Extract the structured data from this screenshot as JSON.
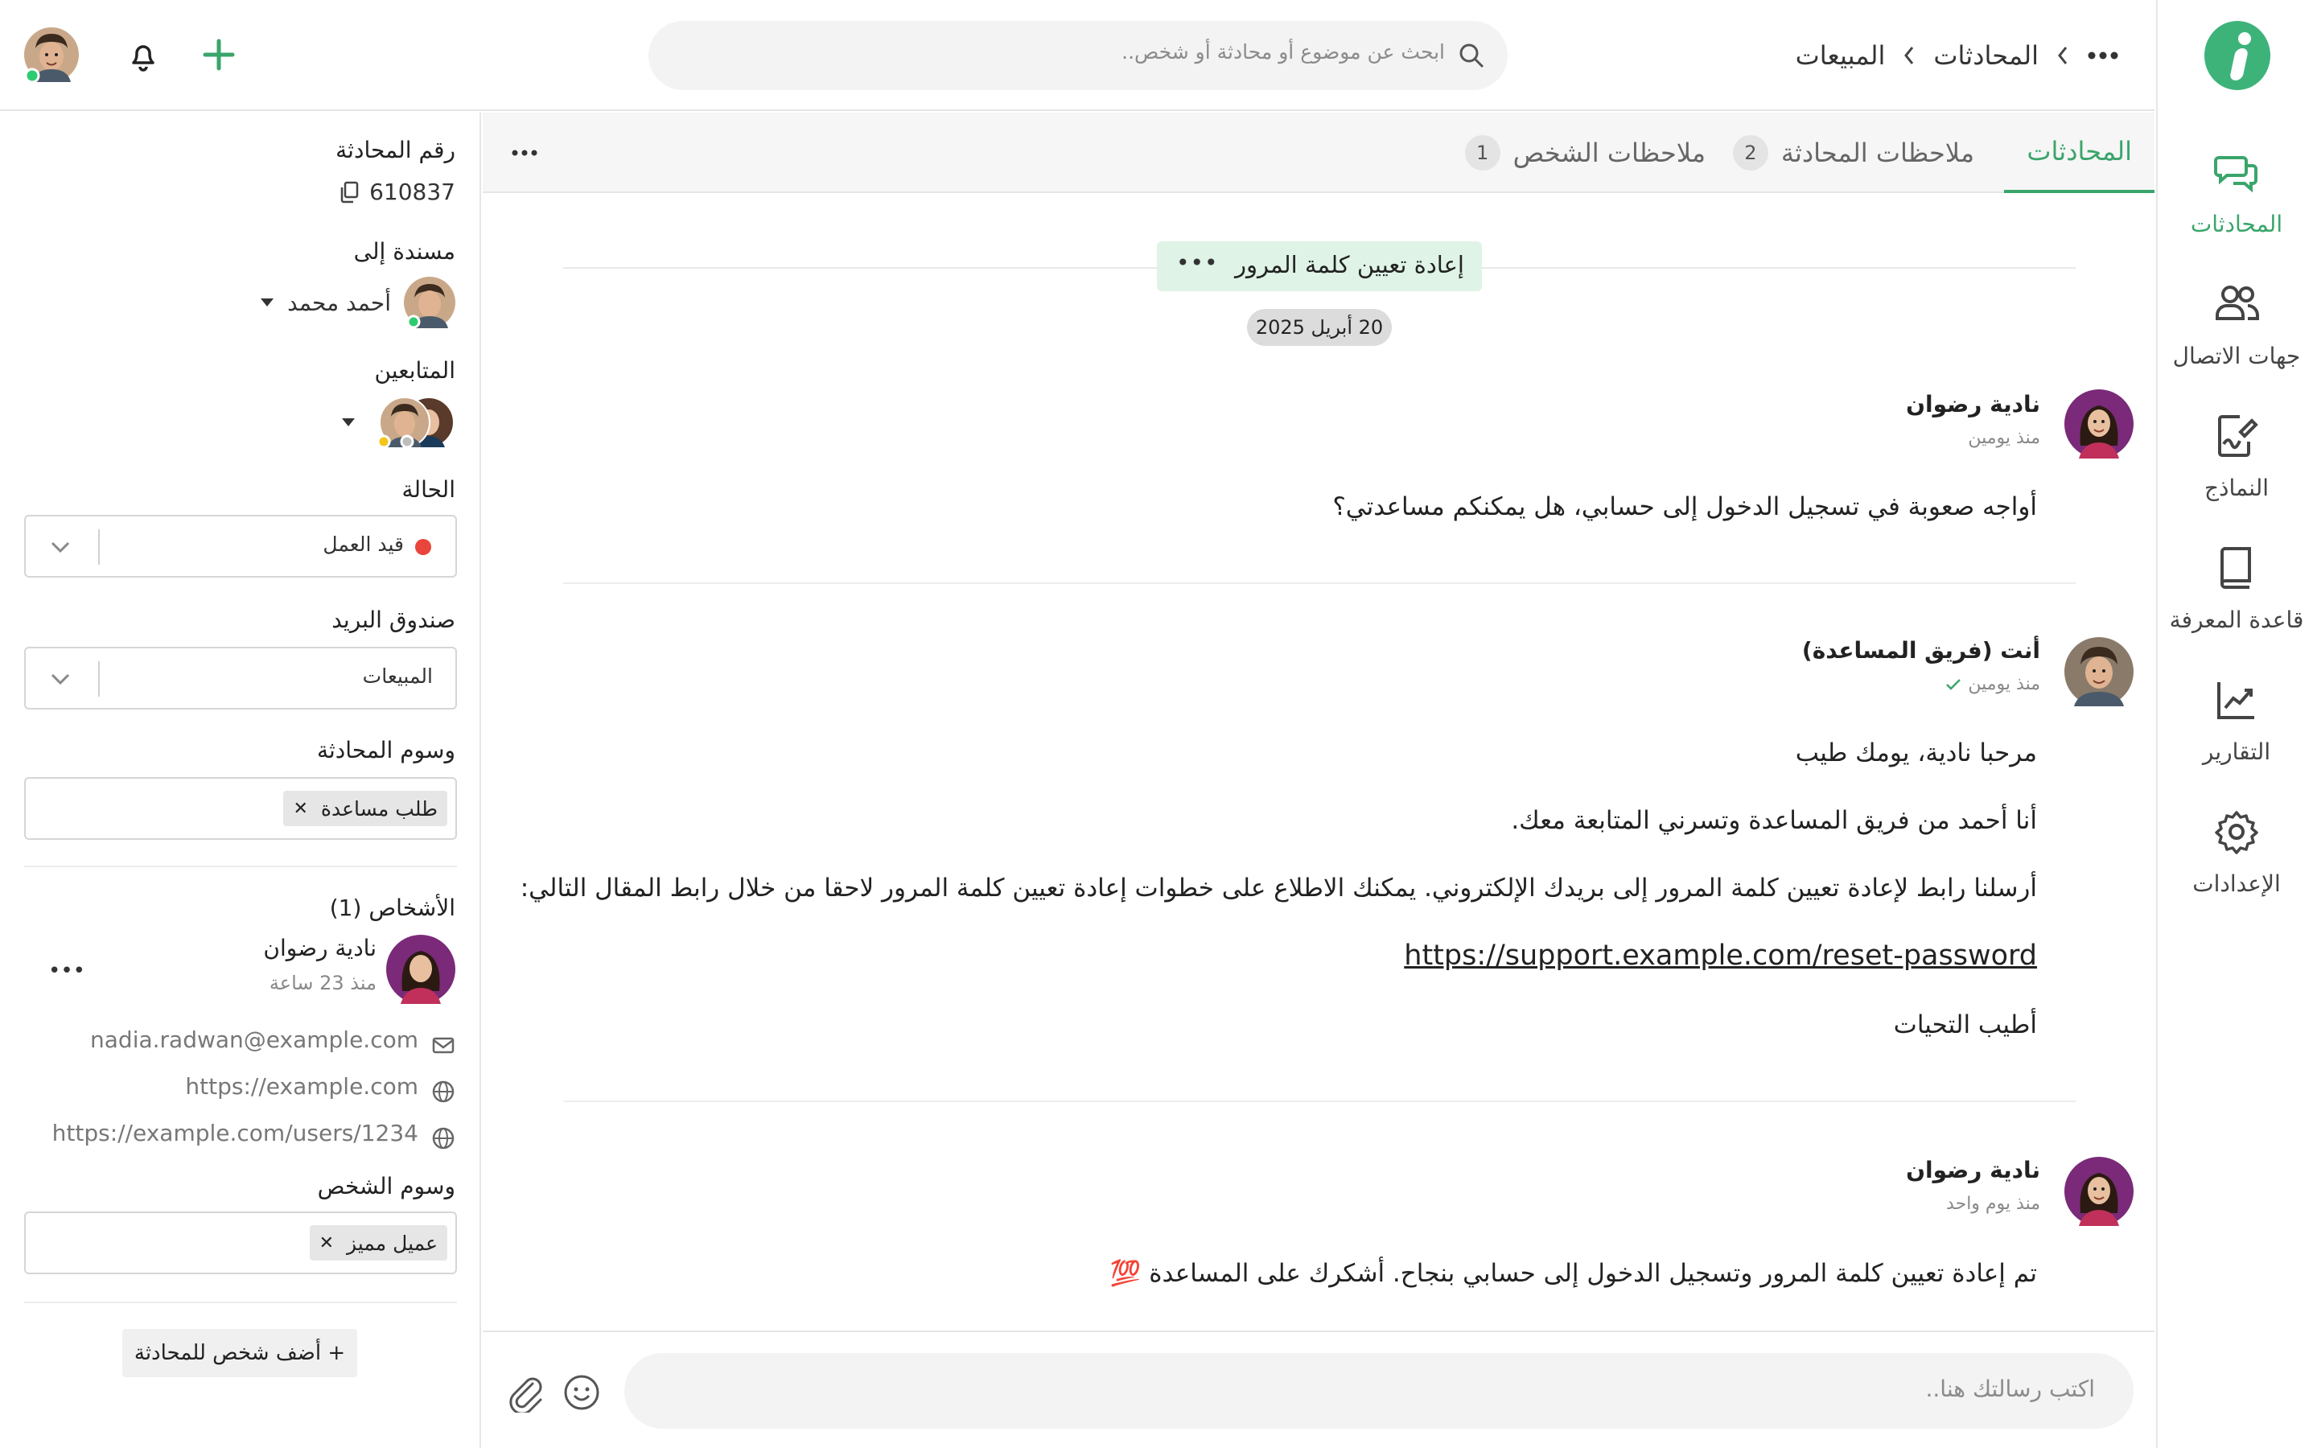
{
  "header": {
    "breadcrumb": [
      "المحادثات",
      "المبيعات"
    ],
    "search_placeholder": "ابحث عن موضوع أو محادثة أو شخص.."
  },
  "nav": {
    "items": [
      {
        "label": "المحادثات",
        "icon": "chat-bubbles-icon",
        "active": true
      },
      {
        "label": "جهات الاتصال",
        "icon": "contacts-icon",
        "active": false
      },
      {
        "label": "النماذج",
        "icon": "forms-icon",
        "active": false
      },
      {
        "label": "قاعدة المعرفة",
        "icon": "book-icon",
        "active": false
      },
      {
        "label": "التقارير",
        "icon": "chart-icon",
        "active": false
      },
      {
        "label": "الإعدادات",
        "icon": "gear-icon",
        "active": false
      }
    ]
  },
  "tabs": [
    {
      "label": "المحادثات",
      "active": true
    },
    {
      "label": "ملاحظات المحادثة",
      "count": "2"
    },
    {
      "label": "ملاحظات الشخص",
      "count": "1"
    }
  ],
  "conversation": {
    "subject": "إعادة تعيين كلمة المرور",
    "date": "20 أبريل 2025",
    "messages": [
      {
        "author": "نادية رضوان",
        "time": "منذ يومين",
        "lines": [
          "أواجه صعوبة في تسجيل الدخول إلى حسابي، هل يمكنكم مساعدتي؟"
        ]
      },
      {
        "author": "أنت (فريق المساعدة)",
        "time": "منذ يومين",
        "lines": [
          "مرحبا نادية، يومك طيب",
          "أنا أحمد من فريق المساعدة وتسرني المتابعة معك.",
          "أرسلنا رابط لإعادة تعيين كلمة المرور إلى بريدك الإلكتروني. يمكنك الاطلاع على خطوات إعادة تعيين كلمة المرور لاحقا من خلال رابط المقال التالي:",
          "https://support.example.com/reset-password",
          "أطيب التحيات"
        ]
      },
      {
        "author": "نادية رضوان",
        "time": "منذ يوم واحد",
        "lines": [
          "تم إعادة تعيين كلمة المرور وتسجيل الدخول إلى حسابي بنجاح. أشكرك على المساعدة 💯"
        ]
      }
    ]
  },
  "composer": {
    "placeholder": "اكتب رسالتك هنا.."
  },
  "panel": {
    "conversation_number_label": "رقم المحادثة",
    "conversation_number": "610837",
    "assigned_label": "مسندة إلى",
    "assigned_to": "أحمد محمد",
    "followers_label": "المتابعين",
    "status_label": "الحالة",
    "status_value": "قيد العمل",
    "status_color": "#e8453c",
    "inbox_label": "صندوق البريد",
    "inbox_value": "المبيعات",
    "conversation_tags_label": "وسوم المحادثة",
    "conversation_tags": [
      "طلب مساعدة"
    ],
    "people_label": "الأشخاص (1)",
    "person": {
      "name": "نادية رضوان",
      "since": "منذ 23 ساعة",
      "email": "nadia.radwan@example.com",
      "website": "https://example.com",
      "profile": "https://example.com/users/1234"
    },
    "person_tags_label": "وسوم الشخص",
    "person_tags": [
      "عميل مميز"
    ],
    "add_person": "+ أضف شخص للمحادثة"
  },
  "colors": {
    "accent": "#3aa56b",
    "online": "#2ecc71",
    "away": "#f5c518"
  }
}
